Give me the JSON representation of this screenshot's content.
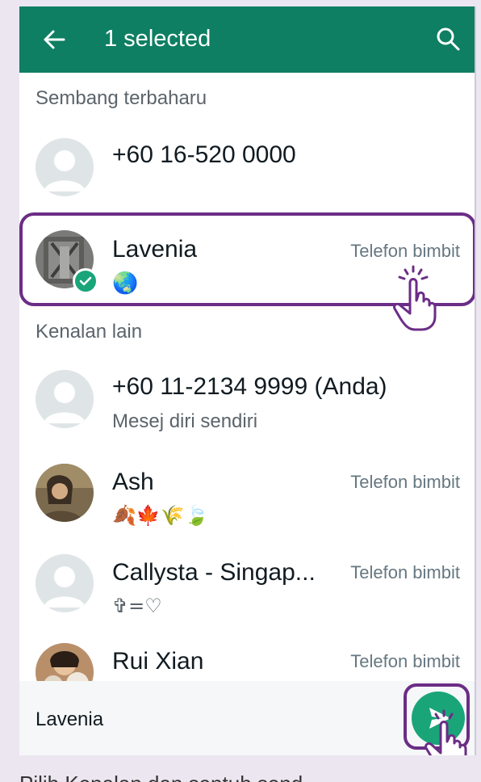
{
  "header": {
    "title": "1 selected",
    "back_icon": "arrow-left-icon",
    "search_icon": "search-icon"
  },
  "sections": {
    "recent": "Sembang terbaharu",
    "other": "Kenalan lain"
  },
  "recent_contacts": [
    {
      "name": "+60 16-520 0000",
      "status": "",
      "type": ""
    },
    {
      "name": "Lavenia",
      "status": "🌏",
      "type": "Telefon bimbit",
      "selected": true
    }
  ],
  "other_contacts": [
    {
      "name": "+60 11-2134 9999 (Anda)",
      "status": "Mesej diri sendiri",
      "type": ""
    },
    {
      "name": "Ash",
      "status": "🍂🍁🌾🍃",
      "type": "Telefon bimbit"
    },
    {
      "name": "Callysta - Singap...",
      "status": "✞=♡",
      "type": "Telefon bimbit"
    },
    {
      "name": "Rui Xian",
      "status": "",
      "type": "Telefon bimbit"
    }
  ],
  "bottom_bar": {
    "selected_names": "Lavenia",
    "send_icon": "send-icon"
  },
  "caption": "Pilih Kenalan dan sentuh send",
  "colors": {
    "header": "#0e7f63",
    "accent": "#1aa579",
    "highlight": "#6b2d86"
  }
}
